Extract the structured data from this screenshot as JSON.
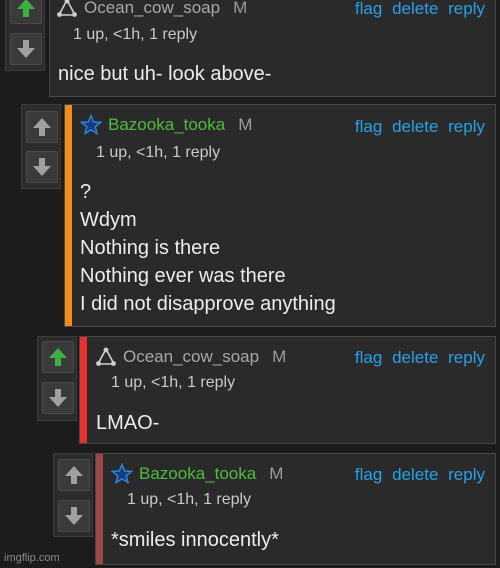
{
  "colors": {
    "background": "#1c1c1c",
    "panel": "#2a2a2a",
    "action_link": "#26a0e8",
    "upvote_active": "#3cb043",
    "username_green": "#4cbe3a",
    "username_gray": "#a8a8a8"
  },
  "comments": [
    {
      "username": "Ocean_cow_soap",
      "mod_badge": "M",
      "flag_label": "flag",
      "delete_label": "delete",
      "reply_label": "reply",
      "meta": "1 up, <1h, 1 reply",
      "lines": [
        "nice but uh- look above-"
      ],
      "upvoted": true,
      "stripe_color": "",
      "user_icon": "triangle-dots-icon"
    },
    {
      "username": "Bazooka_tooka",
      "mod_badge": "M",
      "flag_label": "flag",
      "delete_label": "delete",
      "reply_label": "reply",
      "meta": "1 up, <1h, 1 reply",
      "lines": [
        "?",
        "Wdym",
        "Nothing is there",
        "Nothing ever was there",
        "I did not disapprove anything"
      ],
      "upvoted": false,
      "stripe_color": "#f28c1a",
      "user_icon": "blue-star-icon"
    },
    {
      "username": "Ocean_cow_soap",
      "mod_badge": "M",
      "flag_label": "flag",
      "delete_label": "delete",
      "reply_label": "reply",
      "meta": "1 up, <1h, 1 reply",
      "lines": [
        "LMAO-"
      ],
      "upvoted": true,
      "stripe_color": "#e8302c",
      "user_icon": "triangle-dots-icon"
    },
    {
      "username": "Bazooka_tooka",
      "mod_badge": "M",
      "flag_label": "flag",
      "delete_label": "delete",
      "reply_label": "reply",
      "meta": "1 up, <1h, 1 reply",
      "lines": [
        "*smiles innocently*"
      ],
      "upvoted": false,
      "stripe_color": "#9b4a4a",
      "user_icon": "blue-star-icon"
    }
  ],
  "watermark": "imgflip.com"
}
